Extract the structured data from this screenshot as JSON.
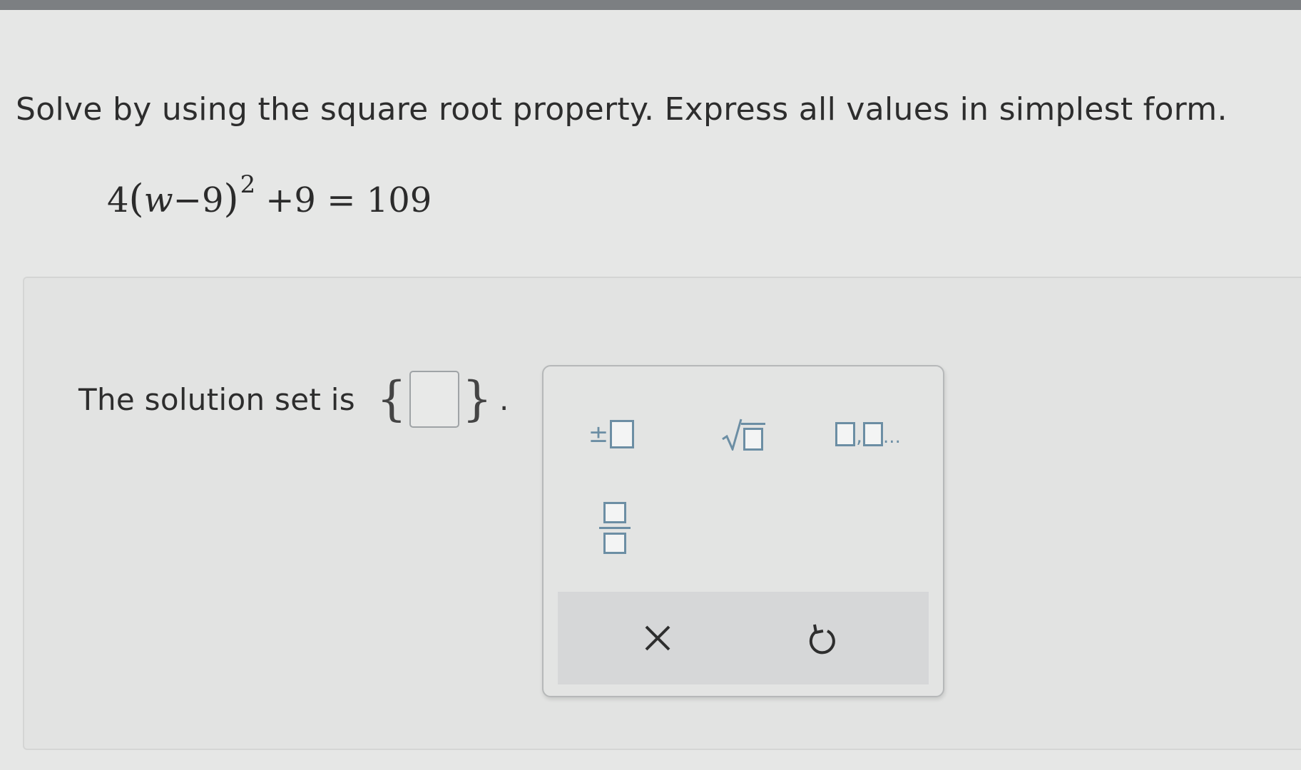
{
  "question": {
    "instruction": "Solve by using the square root property. Express all values in simplest form.",
    "equation": {
      "coefficient": "4",
      "open_paren": "(",
      "variable": "w",
      "minus": "−",
      "inner_number": "9",
      "close_paren": ")",
      "exponent": "2",
      "rest": "+9 = 109"
    }
  },
  "answer": {
    "label": "The solution set is",
    "left_brace": "{",
    "right_brace": "}",
    "period": ".",
    "value": ""
  },
  "palette": {
    "plus_minus_symbol": "±",
    "comma_symbol": ",",
    "dots_symbol": "...",
    "buttons": [
      {
        "icon": "plus-minus-icon"
      },
      {
        "icon": "square-root-icon"
      },
      {
        "icon": "list-icon"
      },
      {
        "icon": "fraction-icon"
      }
    ],
    "actions": [
      {
        "icon": "clear-x-icon"
      },
      {
        "icon": "undo-icon"
      }
    ],
    "accent_color": "#6c8ea4"
  }
}
